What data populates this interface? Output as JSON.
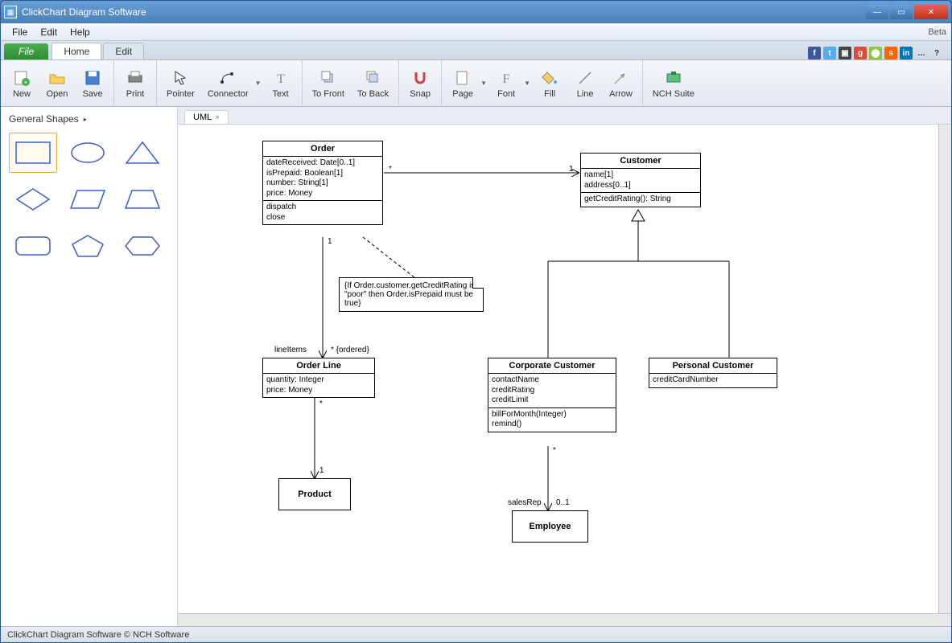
{
  "window": {
    "title": "ClickChart Diagram Software",
    "beta": "Beta"
  },
  "menubar": [
    "File",
    "Edit",
    "Help"
  ],
  "ribbon": {
    "file_tab": "File",
    "tabs": [
      "Home",
      "Edit"
    ],
    "active": "Home",
    "tools": [
      {
        "id": "new",
        "label": "New"
      },
      {
        "id": "open",
        "label": "Open"
      },
      {
        "id": "save",
        "label": "Save"
      },
      {
        "id": "print",
        "label": "Print"
      },
      {
        "id": "pointer",
        "label": "Pointer"
      },
      {
        "id": "connector",
        "label": "Connector"
      },
      {
        "id": "text",
        "label": "Text"
      },
      {
        "id": "tofront",
        "label": "To Front"
      },
      {
        "id": "toback",
        "label": "To Back"
      },
      {
        "id": "snap",
        "label": "Snap"
      },
      {
        "id": "page",
        "label": "Page"
      },
      {
        "id": "font",
        "label": "Font"
      },
      {
        "id": "fill",
        "label": "Fill"
      },
      {
        "id": "line",
        "label": "Line"
      },
      {
        "id": "arrow",
        "label": "Arrow"
      },
      {
        "id": "nchsuite",
        "label": "NCH Suite"
      }
    ]
  },
  "sidebar": {
    "heading": "General Shapes",
    "shapes": [
      "rectangle",
      "ellipse",
      "triangle",
      "diamond",
      "parallelogram",
      "trapezoid",
      "rounded-rect",
      "pentagon",
      "hexagon"
    ],
    "selected": 0
  },
  "document": {
    "tab": "UML"
  },
  "uml": {
    "classes": {
      "order": {
        "name": "Order",
        "attrs": "dateReceived: Date[0..1]\nisPrepaid: Boolean[1]\nnumber: String[1]\nprice: Money",
        "ops": "dispatch\nclose"
      },
      "customer": {
        "name": "Customer",
        "attrs": "name[1]\naddress[0..1]",
        "ops": "getCreditRating(): String"
      },
      "orderline": {
        "name": "Order Line",
        "attrs": "quantity: Integer\nprice: Money"
      },
      "corporate": {
        "name": "Corporate Customer",
        "attrs": "contactName\ncreditRating\ncreditLimit",
        "ops": "billForMonth(Integer)\nremind()"
      },
      "personal": {
        "name": "Personal Customer",
        "attrs": "creditCardNumber"
      },
      "product": {
        "name": "Product"
      },
      "employee": {
        "name": "Employee"
      }
    },
    "note": "{If Order.customer.getCreditRating is \"poor\" then Order.isPrepaid must be true}",
    "labels": {
      "star1": "*",
      "one1": "1",
      "one2": "1",
      "lineItems": "lineItems",
      "ordered": "* {ordered}",
      "star2": "*",
      "one3": "1",
      "star3": "*",
      "salesRep": "salesRep",
      "zeroOne": "0..1"
    }
  },
  "statusbar": "ClickChart Diagram Software © NCH Software"
}
